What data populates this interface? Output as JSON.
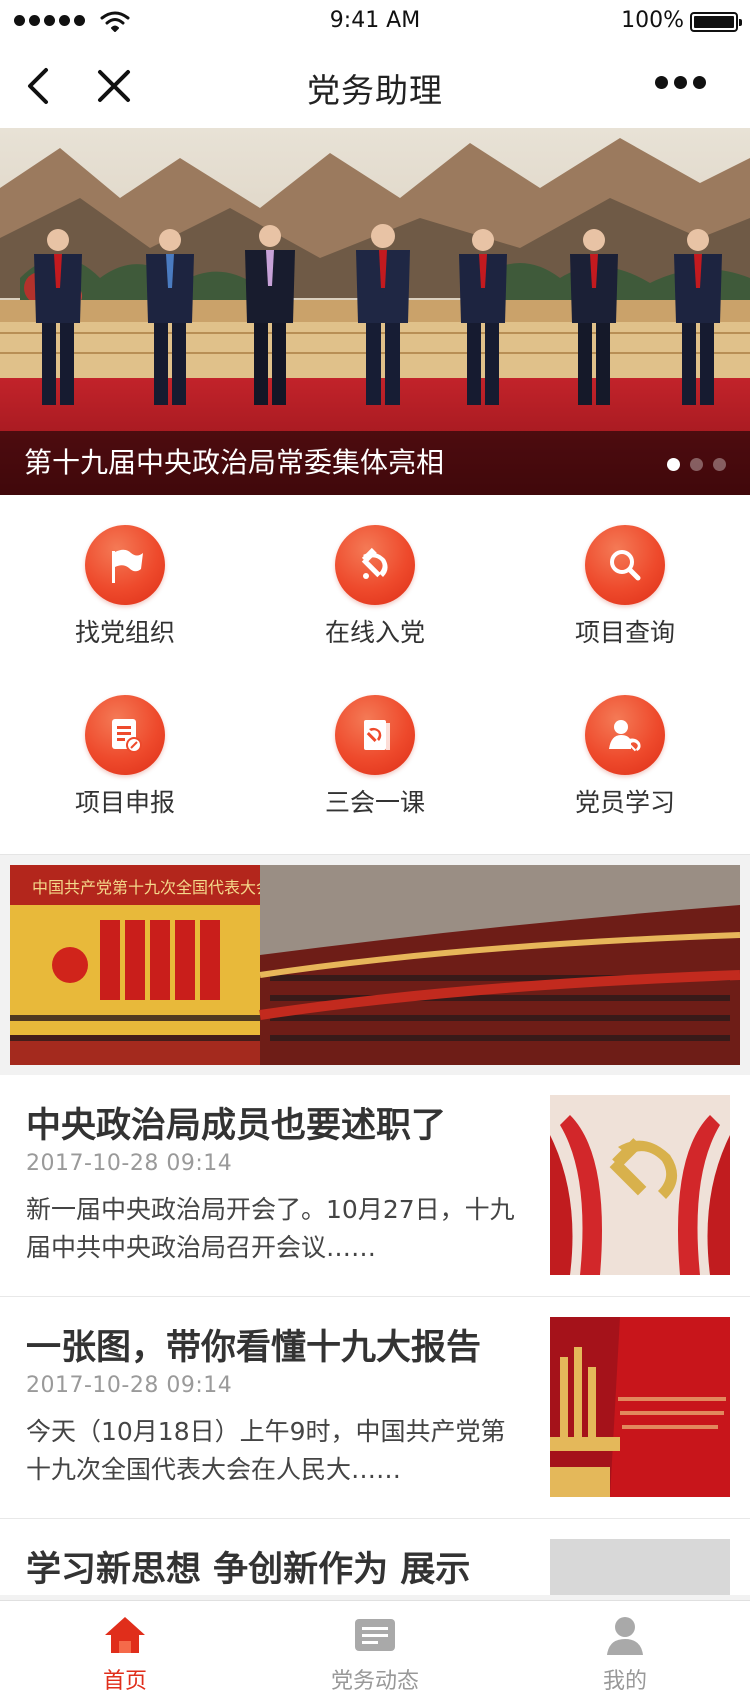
{
  "status_bar": {
    "time": "9:41 AM",
    "battery": "100%"
  },
  "nav": {
    "title": "党务助理"
  },
  "banner": {
    "caption": "第十九届中央政治局常委集体亮相",
    "slide_count": 3,
    "active_slide": 1
  },
  "grid": {
    "items": [
      {
        "label": "找党组织",
        "icon": "flag-icon"
      },
      {
        "label": "在线入党",
        "icon": "hammer-sickle-icon"
      },
      {
        "label": "项目查询",
        "icon": "search-icon"
      },
      {
        "label": "项目申报",
        "icon": "document-edit-icon"
      },
      {
        "label": "三会一课",
        "icon": "party-book-icon"
      },
      {
        "label": "党员学习",
        "icon": "member-study-icon"
      }
    ]
  },
  "promo": {
    "sign": "中国共产党第十九次全国代表大会"
  },
  "news": {
    "items": [
      {
        "title": "中央政治局成员也要述职了",
        "date": "2017-10-28 09:14",
        "summary": "新一届中央政治局开会了。10月27日，十九届中共中央政治局召开会议……"
      },
      {
        "title": "一张图，带你看懂十九大报告",
        "date": "2017-10-28 09:14",
        "summary": "今天（10月18日）上午9时，中国共产党第十九次全国代表大会在人民大……"
      },
      {
        "title": "学习新思想 争创新作为 展示",
        "date": "",
        "summary": ""
      }
    ]
  },
  "tab_bar": {
    "tabs": [
      {
        "label": "首页",
        "icon": "home-icon",
        "active": true
      },
      {
        "label": "党务动态",
        "icon": "news-icon",
        "active": false
      },
      {
        "label": "我的",
        "icon": "user-icon",
        "active": false
      }
    ]
  },
  "colors": {
    "accent": "#e02e1b",
    "icon_red": "#ee4a2c",
    "text": "#333333",
    "muted": "#9a9a9a"
  }
}
